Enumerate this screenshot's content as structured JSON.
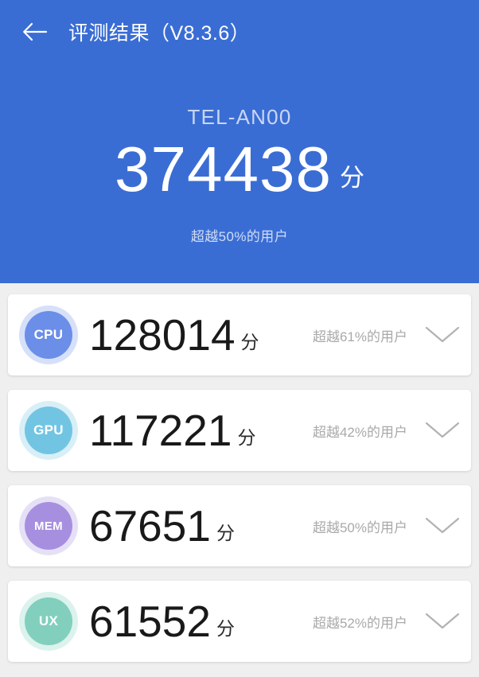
{
  "header": {
    "back_icon": "arrow-left-icon",
    "title": "评测结果（V8.3.6）",
    "background_color": "#3a6dd4",
    "device_name": "TEL-AN00",
    "total_score": "374438",
    "score_unit": "分",
    "percentile_text": "超越50%的用户"
  },
  "cards": [
    {
      "key": "cpu",
      "badge_label": "CPU",
      "badge_color": "#6b8ee8",
      "score": "128014",
      "unit": "分",
      "percentile_text": "超越61%的用户",
      "expand_icon": "chevron-down-icon"
    },
    {
      "key": "gpu",
      "badge_label": "GPU",
      "badge_color": "#72c5e2",
      "score": "117221",
      "unit": "分",
      "percentile_text": "超越42%的用户",
      "expand_icon": "chevron-down-icon"
    },
    {
      "key": "mem",
      "badge_label": "MEM",
      "badge_color": "#a78fe0",
      "score": "67651",
      "unit": "分",
      "percentile_text": "超越50%的用户",
      "expand_icon": "chevron-down-icon"
    },
    {
      "key": "ux",
      "badge_label": "UX",
      "badge_color": "#82cfbe",
      "score": "61552",
      "unit": "分",
      "percentile_text": "超越52%的用户",
      "expand_icon": "chevron-down-icon"
    }
  ]
}
